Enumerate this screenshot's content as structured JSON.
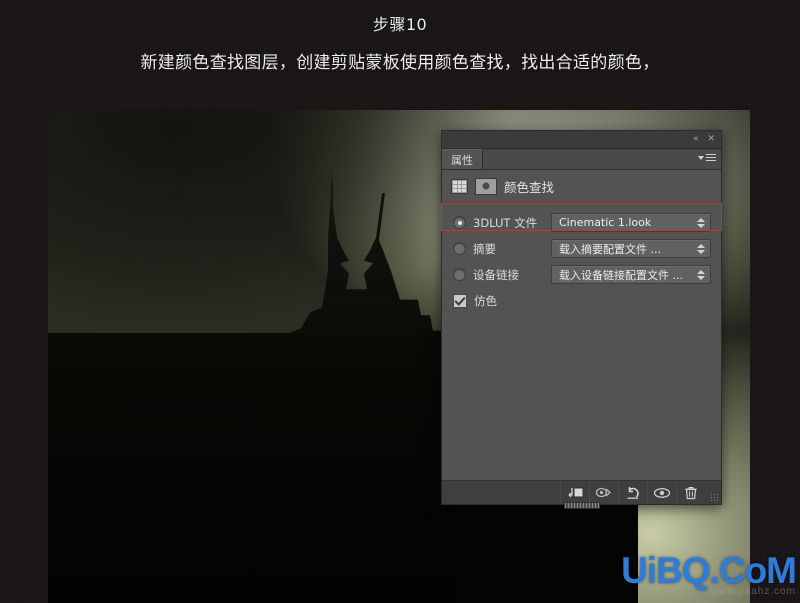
{
  "caption": {
    "step_title": "步骤10",
    "description": "新建颜色查找图层，创建剪贴蒙板使用颜色查找，找出合适的颜色，"
  },
  "photo": {
    "subject": "mont-saint-michel-abbey-silhouette",
    "alt": "Dark moody photo of an abbey on a rock against a pale glowing sky"
  },
  "panel": {
    "tab_label": "属性",
    "header_title": "颜色查找",
    "title_icons": {
      "collapse": "«",
      "close": "✕"
    },
    "grid_icon_name": "color-lookup-grid-icon",
    "mask_icon_name": "layer-mask-thumbnail-icon",
    "rows": [
      {
        "control": "radio",
        "selected": true,
        "label": "3DLUT 文件",
        "value": "Cinematic 1.look",
        "highlighted": true
      },
      {
        "control": "radio",
        "selected": false,
        "label": "摘要",
        "value": "载入摘要配置文件 ...",
        "highlighted": false
      },
      {
        "control": "radio",
        "selected": false,
        "label": "设备链接",
        "value": "载入设备链接配置文件 ...",
        "highlighted": false
      }
    ],
    "checkbox_row": {
      "control": "checkbox",
      "checked": true,
      "label": "仿色"
    },
    "footer_buttons": [
      {
        "name": "clip-to-layer-icon",
        "glyph": "⎘"
      },
      {
        "name": "view-previous-state-icon",
        "glyph": "◉"
      },
      {
        "name": "reset-icon",
        "glyph": "↺"
      },
      {
        "name": "toggle-visibility-eye-icon",
        "glyph": "👁"
      },
      {
        "name": "delete-trash-icon",
        "glyph": "🗑"
      }
    ],
    "highlight_color": "#c0392b"
  },
  "watermark": {
    "main": "UiBQ.CoM",
    "sub": "www.psahz.com",
    "color": "#2f7bd8"
  }
}
